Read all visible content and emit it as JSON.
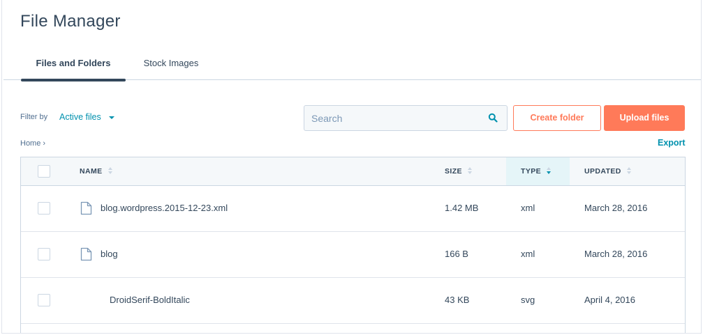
{
  "page": {
    "title": "File Manager"
  },
  "tabs": [
    {
      "label": "Files and Folders",
      "active": true
    },
    {
      "label": "Stock Images",
      "active": false
    }
  ],
  "filter": {
    "label": "Filter by",
    "value": "Active files"
  },
  "search": {
    "placeholder": "Search",
    "value": ""
  },
  "buttons": {
    "create_folder": "Create folder",
    "upload_files": "Upload files"
  },
  "breadcrumb": {
    "home": "Home ›"
  },
  "export_label": "Export",
  "table": {
    "columns": [
      {
        "label": "NAME",
        "sorted": false
      },
      {
        "label": "SIZE",
        "sorted": false
      },
      {
        "label": "TYPE",
        "sorted": true,
        "direction": "desc"
      },
      {
        "label": "UPDATED",
        "sorted": false
      }
    ],
    "rows": [
      {
        "name": "blog.wordpress.2015-12-23.xml",
        "size": "1.42 MB",
        "type": "xml",
        "updated": "March 28, 2016",
        "icon": "file-icon"
      },
      {
        "name": "blog",
        "size": "166 B",
        "type": "xml",
        "updated": "March 28, 2016",
        "icon": "file-icon"
      },
      {
        "name": "DroidSerif-BoldItalic",
        "size": "43 KB",
        "type": "svg",
        "updated": "April 4, 2016",
        "icon": ""
      }
    ]
  },
  "colors": {
    "accent_orange": "#ff7a59",
    "link_teal": "#0091ae",
    "text_dark": "#33475b",
    "sorted_header_bg": "#e5f5f8"
  }
}
